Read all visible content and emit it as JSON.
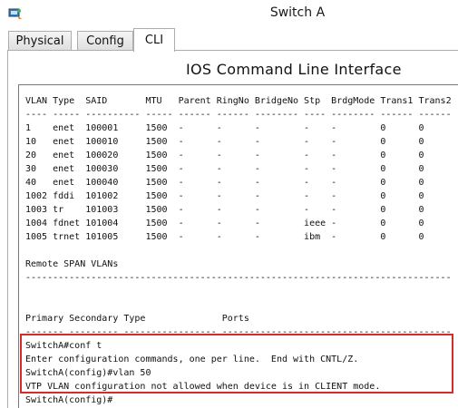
{
  "window": {
    "title": "Switch A"
  },
  "tabs": [
    {
      "label": "Physical",
      "active": false
    },
    {
      "label": "Config",
      "active": false
    },
    {
      "label": "CLI",
      "active": true
    }
  ],
  "cli": {
    "heading": "IOS Command Line Interface",
    "lines": [
      "VLAN Type  SAID       MTU   Parent RingNo BridgeNo Stp  BrdgMode Trans1 Trans2",
      "---- ----- ---------- ----- ------ ------ -------- ---- -------- ------ ------",
      "1    enet  100001     1500  -      -      -        -    -        0      0",
      "10   enet  100010     1500  -      -      -        -    -        0      0",
      "20   enet  100020     1500  -      -      -        -    -        0      0",
      "30   enet  100030     1500  -      -      -        -    -        0      0",
      "40   enet  100040     1500  -      -      -        -    -        0      0",
      "1002 fddi  101002     1500  -      -      -        -    -        0      0",
      "1003 tr    101003     1500  -      -      -        -    -        0      0",
      "1004 fdnet 101004     1500  -      -      -        ieee -        0      0",
      "1005 trnet 101005     1500  -      -      -        ibm  -        0      0",
      "",
      "Remote SPAN VLANs",
      "------------------------------------------------------------------------------",
      "",
      "",
      "Primary Secondary Type              Ports",
      "------- --------- ----------------- ------------------------------------------",
      "SwitchA#conf t",
      "Enter configuration commands, one per line.  End with CNTL/Z.",
      "SwitchA(config)#vlan 50",
      "VTP VLAN configuration not allowed when device is in CLIENT mode.",
      "SwitchA(config)#"
    ]
  },
  "highlight": {
    "color": "#d42b2b"
  }
}
